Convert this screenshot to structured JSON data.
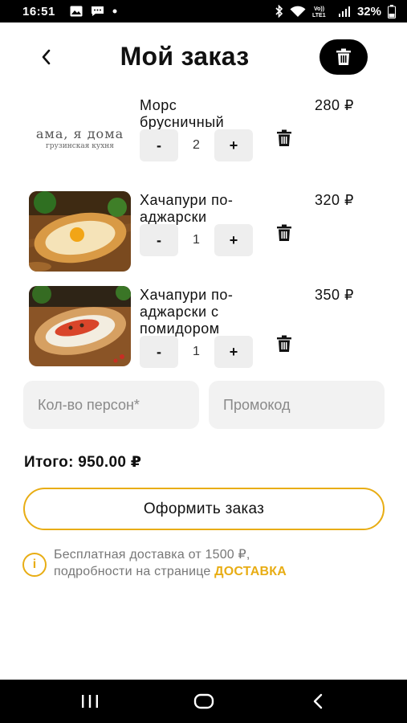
{
  "status_bar": {
    "time": "16:51",
    "battery": "32%",
    "icons": [
      "image-icon",
      "chat-icon",
      "dot-icon",
      "bluetooth-icon",
      "wifi-icon",
      "volte-icon",
      "signal-icon",
      "battery-icon"
    ],
    "volte_label": "Vo)) LTE1"
  },
  "header": {
    "title": "Мой заказ",
    "back_icon": "chevron-left-icon",
    "clear_icon": "trash-icon"
  },
  "items": [
    {
      "name": "Морс брусничный",
      "price": "280 ₽",
      "quantity": "2",
      "minus_label": "-",
      "plus_label": "+",
      "thumb": "logo",
      "logo_text": "ама, я дома",
      "logo_sub": "грузинская кухня"
    },
    {
      "name": "Хачапури по-аджарски",
      "price": "320 ₽",
      "quantity": "1",
      "minus_label": "-",
      "plus_label": "+",
      "thumb": "khachapuri-egg"
    },
    {
      "name": "Хачапури по-аджарски с помидором",
      "price": "350 ₽",
      "quantity": "1",
      "minus_label": "-",
      "plus_label": "+",
      "thumb": "khachapuri-tomato"
    }
  ],
  "form": {
    "persons_placeholder": "Кол-во персон*",
    "promo_placeholder": "Промокод"
  },
  "total": "Итого: 950.00 ₽",
  "checkout_label": "Оформить заказ",
  "info": {
    "line1": "Бесплатная доставка от 1500 ₽,",
    "line2": "подробности на странице ",
    "link": "ДОСТАВКА"
  },
  "colors": {
    "accent": "#e8ad14",
    "field_bg": "#f2f2f2",
    "qty_bg": "#eeeeee"
  },
  "nav_bar": {
    "icons": [
      "recents-icon",
      "home-icon",
      "back-icon"
    ]
  }
}
